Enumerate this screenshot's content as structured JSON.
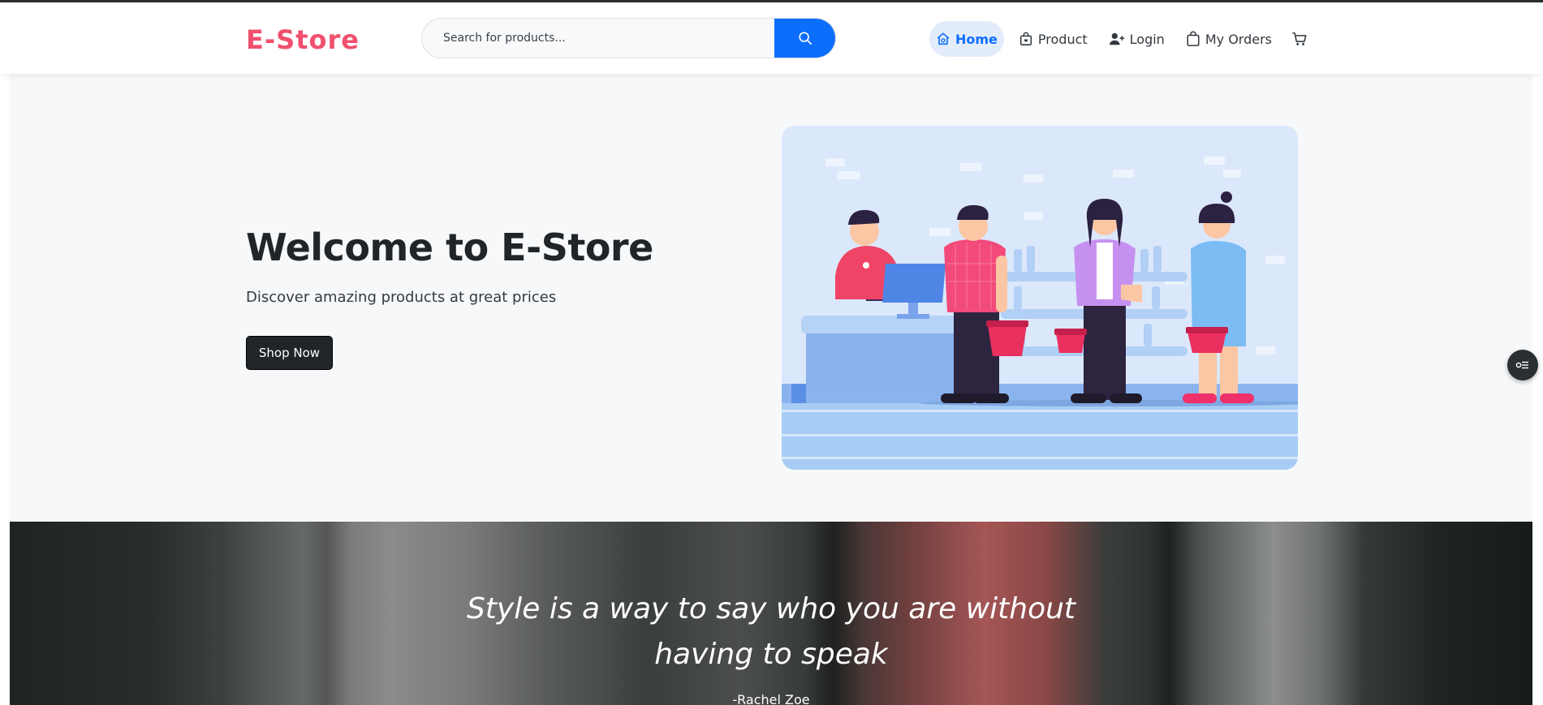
{
  "brand": {
    "name": "E-Store",
    "color": "#f0506e"
  },
  "search": {
    "placeholder": "Search for products...",
    "value": "",
    "button_icon": "search-icon"
  },
  "nav": {
    "items": [
      {
        "label": "Home",
        "icon": "home-icon",
        "active": true
      },
      {
        "label": "Product",
        "icon": "shopping-bag-icon",
        "active": false
      },
      {
        "label": "Login",
        "icon": "user-plus-icon",
        "active": false
      },
      {
        "label": "My Orders",
        "icon": "bag-icon",
        "active": false
      }
    ],
    "cart_icon": "cart-icon"
  },
  "hero": {
    "title": "Welcome to E-Store",
    "subtitle": "Discover amazing products at great prices",
    "cta_label": "Shop Now",
    "illustration": "shoppers-at-checkout-illustration"
  },
  "quote": {
    "line1": "Style is a way to say who you are without",
    "line2": "having to speak",
    "author": "-Rachel Zoe"
  },
  "floating_button_icon": "toggle-list-icon",
  "colors": {
    "accent": "#0d6efd",
    "active_nav_bg": "#e2ecfb",
    "dark_button": "#212529",
    "hero_bg": "#f7f8f9"
  }
}
